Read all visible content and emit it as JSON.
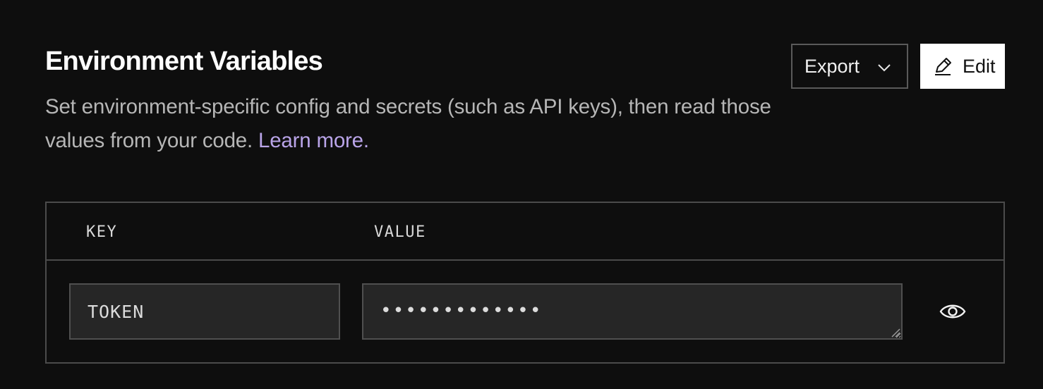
{
  "header": {
    "title": "Environment Variables",
    "description": "Set environment-specific config and secrets (such as API keys), then read those values from your code.",
    "learn_more": "Learn more."
  },
  "toolbar": {
    "export_label": "Export",
    "edit_label": "Edit"
  },
  "table": {
    "columns": [
      "KEY",
      "VALUE"
    ],
    "rows": [
      {
        "key": "TOKEN",
        "value_masked": "•••••••••••••"
      }
    ]
  },
  "icons": {
    "export_dropdown": "chevron-down-icon",
    "edit": "pencil-icon",
    "reveal": "eye-icon"
  },
  "colors": {
    "background": "#0e0e0e",
    "link": "#b9a4e8",
    "border": "#4b4b4b",
    "input_bg": "#262626"
  }
}
